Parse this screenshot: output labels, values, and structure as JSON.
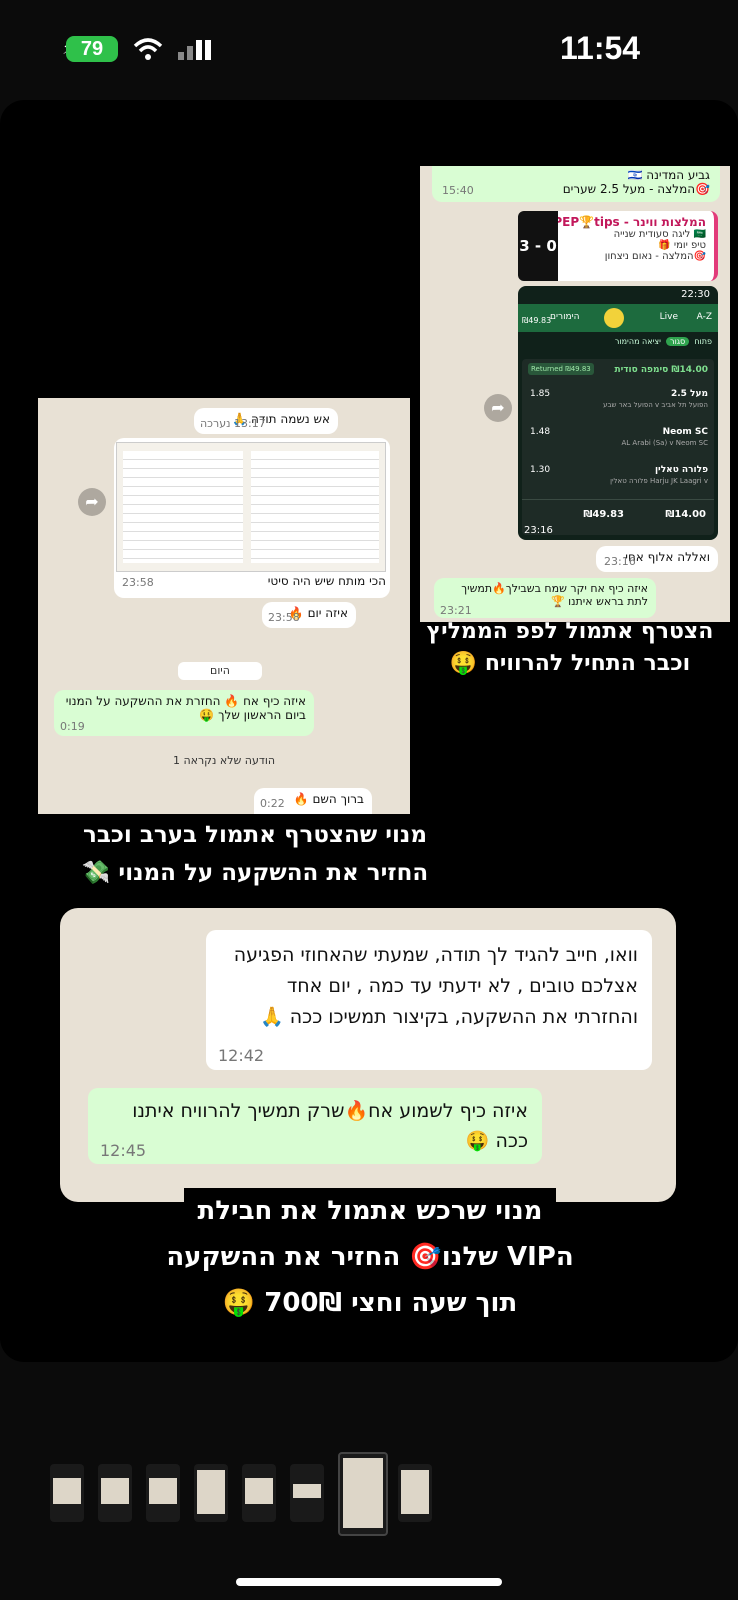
{
  "status_bar": {
    "battery": "79",
    "time": "11:54"
  },
  "shot_right": {
    "top_lines": [
      "גביע המדינה 🇮🇱",
      "🎯המלצה - מעל 2.5 שערים"
    ],
    "top_time": "15:40",
    "card_title": "המלצות ווינר - PEP🏆tips...",
    "card_lines": [
      "🇸🇦 ליגה סעודית שנייה",
      "טיפ יומי 🎁",
      "🎯המלצה - נאום ניצחון"
    ],
    "card_score": "3 - 0",
    "phone": {
      "clock": "22:30",
      "balance": "₪49.83",
      "tab_sport": "הימורים",
      "tab_live": "Live",
      "tab_az": "A-Z",
      "filters": [
        "פתוח",
        "סגור",
        "יציאה מהימור"
      ],
      "bet_title": "₪14.00 סימפה סודית",
      "returned": "₪49.83 Returned",
      "rows": [
        {
          "odd": "1.85",
          "name": "מעל 2.5",
          "sub": "הפועל תל אביב v הפועל באר שבע"
        },
        {
          "odd": "1.48",
          "name": "Neom SC",
          "sub": "AL Arabi (Sa) v Neom SC"
        },
        {
          "odd": "1.30",
          "name": "פלורה טאלין",
          "sub": "Harju JK Laagri v פלורה טאלין"
        }
      ],
      "total_return": "₪49.83",
      "stake": "₪14.00",
      "vid_time": "23:16"
    },
    "reply1": "ואללה אלוף אחי",
    "reply1_time": "23:16",
    "reply2": "איזה כיף אח יקר שמח בשבילך🔥תמשיך לתת בראש איתנו 🏆",
    "reply2_time": "23:21"
  },
  "caption_right": "הצטרף אתמול לפפ הממליץ וכבר התחיל להרוויח 🤑",
  "shot_left": {
    "msg1": "אש נשמה תודה 🙏",
    "msg1_time": "13:17 נערכה",
    "img_caption": "הכי מותח שיש היה סיטי",
    "img_time": "23:58",
    "msg2": "איזה יום 🔥",
    "msg2_time": "23:58",
    "day": "היום",
    "msg3": "איזה כיף אח 🔥 החזרת את ההשקעה על המנוי ביום הראשון שלך 🤑",
    "msg3_time": "0:19",
    "unread": "1 הודעה שלא נקראה",
    "msg4": "ברוך השם 🔥",
    "msg4_time": "0:22"
  },
  "caption_left": [
    "מנוי שהצטרף אתמול בערב וכבר",
    "החזיר את ההשקעה על המנוי 💸"
  ],
  "shot_bottom": {
    "msg_in": "וואו, חייב להגיד לך תודה, שמעתי שהאחוזי הפגיעה אצלכם טובים , לא ידעתי עד כמה , יום אחד והחזרתי את ההשקעה, בקיצור תמשיכו ככה 🙏",
    "msg_in_time": "12:42",
    "msg_out": "איזה כיף לשמוע אח🔥שרק תמשיך להרוויח איתנו ככה 🤑",
    "msg_out_time": "12:45"
  },
  "caption_bottom": [
    "מנוי שרכש אתמול את חבילת",
    "הVIP שלנו🎯 החזיר את ההשקעה",
    "תוך שעה וחצי 700₪ 🤑"
  ],
  "colors": {
    "battery": "#2fc14a",
    "chat_bg": "#e8e1d5",
    "bubble_out": "#d9fdd3",
    "phone_green": "#1d6b3e"
  }
}
